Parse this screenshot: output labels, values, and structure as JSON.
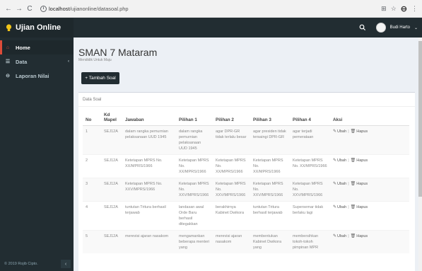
{
  "browser": {
    "url_host": "localhost",
    "url_path": "/ujianonline/datasoal.php"
  },
  "app": {
    "title": "Ujian Online",
    "user_name": "Budi Harto",
    "user_caret": "⌄"
  },
  "sidebar": {
    "items": [
      {
        "label": "Home",
        "icon": "home-icon"
      },
      {
        "label": "Data",
        "icon": "list-icon",
        "caret": "‹"
      },
      {
        "label": "Laporan Nilai",
        "icon": "report-icon"
      }
    ],
    "footer": "© 2019 Rojib Cipto.",
    "collapse_glyph": "‹"
  },
  "page": {
    "title": "SMAN 7 Mataram",
    "subtitle": "Mendidik Untuk Maju",
    "add_button": "+ Tambah Soal",
    "box_title": "Data Soal"
  },
  "table": {
    "headers": [
      "No",
      "Kd Mapel",
      "Jawaban",
      "Pilihan 1",
      "Pilihan 2",
      "Pilihan 3",
      "Pilihan 4",
      "Aksi"
    ],
    "edit_label": "Ubah",
    "delete_label": "Hapus",
    "rows": [
      {
        "no": "1",
        "kd": "SEJ12A",
        "jawaban": "dalam rangka pemurnian pelaksanaan UUD 1945",
        "p1": "dalam rangka pemurnian pelaksanaan UUD 1945",
        "p2": "agar DPR-GR tidak terlalu besar",
        "p3": "agar presiden tidak tersaingi DPR-GR",
        "p4": "agar terjadi pemerataan"
      },
      {
        "no": "2",
        "kd": "SEJ12A",
        "jawaban": "Ketetapan MPRS No. XX/MPRS/1966",
        "p1": "Ketetapan MPRS No. XX/MPRS/1966",
        "p2": "Ketetapan MPRS No. XX/MPRS/1966",
        "p3": "Ketetapan MPRS No. XX/MPRS/1966",
        "p4": "Ketetapan MPRS No. XX/MPRS/1966"
      },
      {
        "no": "3",
        "kd": "SEJ12A",
        "jawaban": "Ketetapan MPRS No. XXV/MPRS/1966",
        "p1": "Ketetapan MPRS No. XXV/MPRS/1966",
        "p2": "Ketetapan MPRS No. XXV/MPRS/1966",
        "p3": "Ketetapan MPRS No. XXV/MPRS/1966",
        "p4": "Ketetapan MPRS No. XXV/MPRS/1966"
      },
      {
        "no": "4",
        "kd": "SEJ12A",
        "jawaban": "tuntutan Tritura berhasil terjawab",
        "p1": "landasan awal Orde Baru berhasil ditegakkan",
        "p2": "berakhirnya Kabinet Dwikora",
        "p3": "tuntutan Tritura berhasil terjawab",
        "p4": "Supersemar tidak berlaku lagi"
      },
      {
        "no": "5",
        "kd": "SEJ12A",
        "jawaban": "merevisi ajaran nasakom",
        "p1": "mengamankan beberapa menteri yang",
        "p2": "merevisi ajaran nasakom",
        "p3": "membentukan Kabinet Dwikora yang",
        "p4": "membersihkan tokoh-tokoh pimpinan MPR"
      }
    ]
  }
}
